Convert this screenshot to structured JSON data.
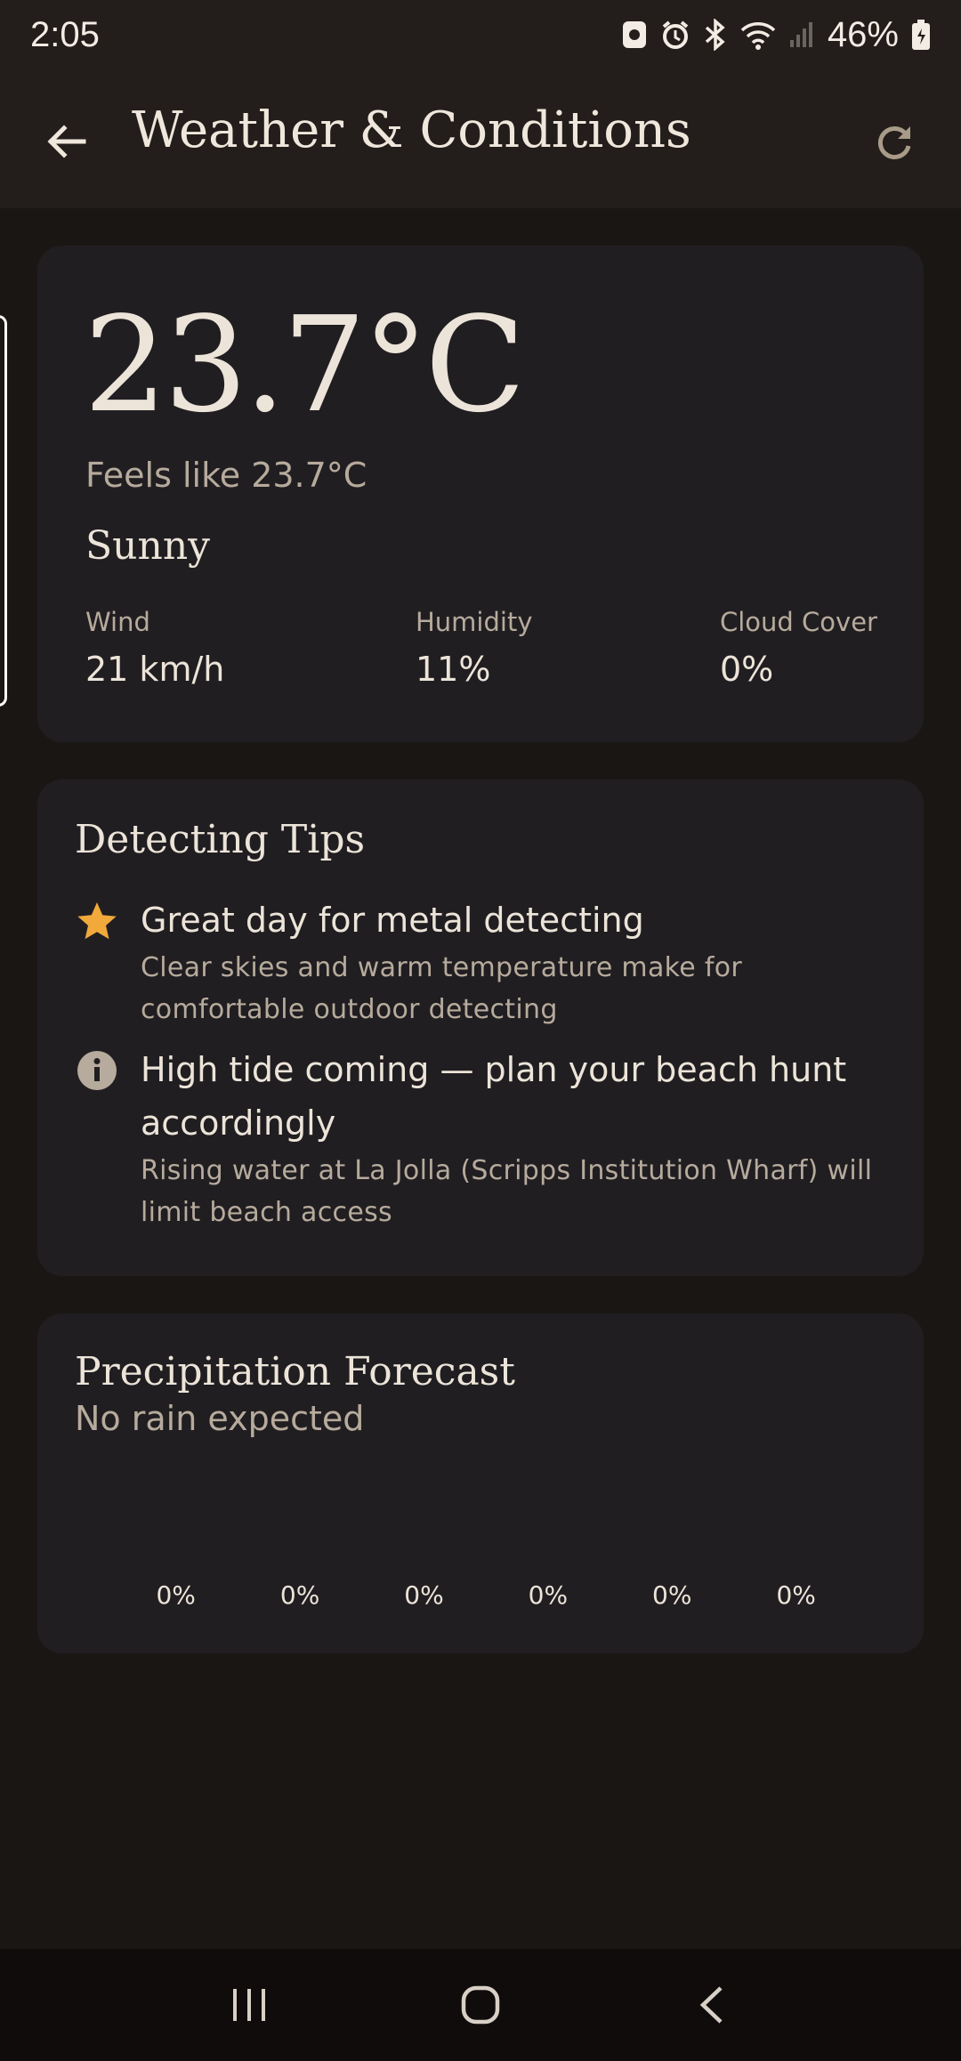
{
  "status_bar": {
    "time": "2:05",
    "battery": "46%"
  },
  "app_bar": {
    "title": "Weather & Conditions",
    "back_icon": "arrow-left-icon",
    "refresh_icon": "refresh-icon"
  },
  "weather": {
    "temperature": "23.7°C",
    "feels_like": "Feels like 23.7°C",
    "condition": "Sunny",
    "stats": [
      {
        "label": "Wind",
        "value": "21 km/h"
      },
      {
        "label": "Humidity",
        "value": "11%"
      },
      {
        "label": "Cloud Cover",
        "value": "0%"
      }
    ]
  },
  "tips": {
    "title": "Detecting Tips",
    "items": [
      {
        "icon": "star-icon",
        "title": "Great day for metal detecting",
        "desc_line1": "Clear skies and warm temperature make for",
        "desc_line2": "comfortable outdoor detecting"
      },
      {
        "icon": "info-icon",
        "title_line1": "High tide coming — plan your beach hunt",
        "title_line2": "accordingly",
        "desc_line1": "Rising water at La Jolla (Scripps Institution Wharf) will",
        "desc_line2": "limit beach access"
      }
    ]
  },
  "precipitation": {
    "title": "Precipitation Forecast",
    "subtitle": "No rain expected",
    "values": [
      "0%",
      "0%",
      "0%",
      "0%",
      "0%",
      "0%"
    ]
  },
  "colors": {
    "background": "#1a1614",
    "card": "#211e22",
    "accent_star": "#f0a93a",
    "text_primary": "#ece4d8",
    "text_secondary": "#b6ab9c"
  }
}
